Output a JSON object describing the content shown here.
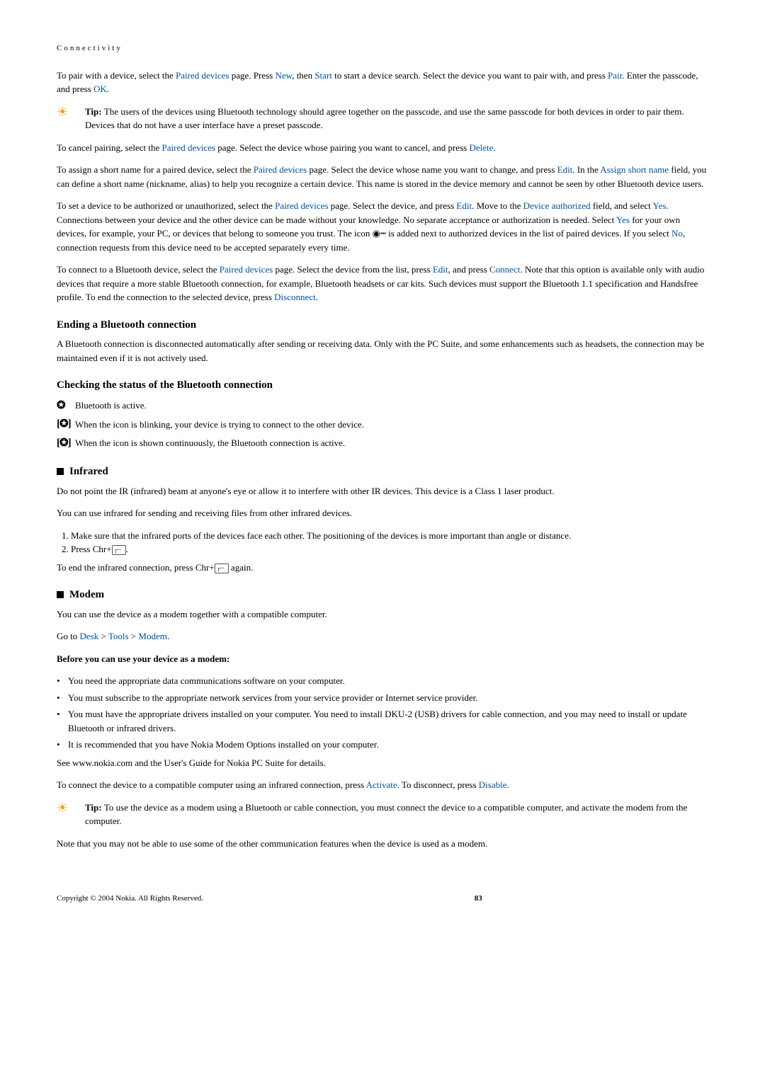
{
  "header": {
    "label": "Connectivity"
  },
  "p1": {
    "t1": "To pair with a device, select the ",
    "l1": "Paired devices",
    "t2": " page. Press ",
    "l2": "New",
    "t3": ", then ",
    "l3": "Start",
    "t4": " to start a device search. Select the device you want to pair with, and press ",
    "l4": "Pair",
    "t5": ". Enter the passcode, and press ",
    "l5": "OK",
    "t6": "."
  },
  "tip1": {
    "label": "Tip: ",
    "text": "The users of the devices using Bluetooth technology should agree together on the passcode, and use the same passcode for both devices in order to pair them. Devices that do not have a user interface have a preset passcode."
  },
  "p2": {
    "t1": "To cancel pairing, select the ",
    "l1": "Paired devices",
    "t2": " page. Select the device whose pairing you want to cancel, and press ",
    "l2": "Delete",
    "t3": "."
  },
  "p3": {
    "t1": "To assign a short name for a paired device, select the ",
    "l1": "Paired devices",
    "t2": " page. Select the device whose name you want to change, and press ",
    "l2": "Edit",
    "t3": ". In the ",
    "l3": "Assign short name",
    "t4": " field, you can define a short name (nickname, alias) to help you recognize a certain device. This name is stored in the device memory and cannot be seen by other Bluetooth device users."
  },
  "p4": {
    "t1": "To set a device to be authorized or unauthorized, select the ",
    "l1": "Paired devices",
    "t2": " page. Select the device, and press ",
    "l2": "Edit",
    "t3": ". Move to the ",
    "l3": "Device authorized",
    "t4": " field, and select ",
    "l4": "Yes",
    "t5": ". Connections between your device and the other device can be made without your knowledge. No separate acceptance or authorization is needed. Select ",
    "l5": "Yes",
    "t6": " for your own devices, for example, your PC, or devices that belong to someone you trust. The icon ",
    "t7": " is added next to authorized devices in the list of paired devices. If you select ",
    "l6": "No",
    "t8": ", connection requests from this device need to be accepted separately every time."
  },
  "p5": {
    "t1": "To connect to a Bluetooth device, select the ",
    "l1": "Paired devices",
    "t2": " page. Select the device from the list, press ",
    "l2": "Edit",
    "t3": ", and press ",
    "l3": "Connect",
    "t4": ". Note that this option is available only with audio devices that require a more stable Bluetooth connection, for example, Bluetooth headsets or car kits. Such devices must support the Bluetooth 1.1 specification and Handsfree profile. To end the connection to the selected device, press ",
    "l4": "Disconnect",
    "t5": "."
  },
  "h_ending": "Ending a Bluetooth connection",
  "p_ending": "A Bluetooth connection is disconnected automatically after sending or receiving data. Only with the PC Suite, and some enhancements such as headsets, the connection may be maintained even if it is not actively used.",
  "h_checking": "Checking the status of the Bluetooth connection",
  "status": {
    "s1": "Bluetooth is active.",
    "s2": "When the icon is blinking, your device is trying to connect to the other device.",
    "s3": "When the icon is shown continuously, the Bluetooth connection is active."
  },
  "h_infrared": "Infrared",
  "ir_p1": "Do not point the IR (infrared) beam at anyone's eye or allow it to interfere with other IR devices. This device is a Class 1 laser product.",
  "ir_p2": "You can use infrared for sending and receiving files from other infrared devices.",
  "ir_li1": "Make sure that the infrared ports of the devices face each other. The positioning of the devices is more important than angle or distance.",
  "ir_li2a": "Press Chr+",
  "ir_li2b": ".",
  "ir_p3a": "To end the infrared connection, press Chr+",
  "ir_p3b": " again.",
  "h_modem": "Modem",
  "md_p1": "You can use the device as a modem together with a compatible computer.",
  "md_goto": {
    "t1": "Go to ",
    "l1": "Desk",
    "t2": " > ",
    "l2": "Tools",
    "t3": " > ",
    "l3": "Modem",
    "t4": "."
  },
  "md_before": "Before you can use your device as a modem:",
  "md_b1": "You need the appropriate data communications software on your computer.",
  "md_b2": "You must subscribe to the appropriate network services from your service provider or Internet service provider.",
  "md_b3": "You must have the appropriate drivers installed on your computer. You need to install DKU-2 (USB) drivers for cable connection, and you may need to install or update Bluetooth or infrared drivers.",
  "md_b4": "It is recommended that you have Nokia Modem Options installed on your computer.",
  "md_p2": "See www.nokia.com and the User's Guide for Nokia PC Suite for details.",
  "md_p3": {
    "t1": "To connect the device to a compatible computer using an infrared connection, press ",
    "l1": "Activate",
    "t2": ". To disconnect, press ",
    "l2": "Disable",
    "t3": "."
  },
  "tip2": {
    "label": "Tip: ",
    "text": "To use the device as a modem using a Bluetooth or cable connection, you must connect the device to a compatible computer, and activate the modem from the computer."
  },
  "md_p4": "Note that you may not be able to use some of the other communication features when the device is used as a modem.",
  "footer": {
    "copyright": "Copyright © 2004 Nokia. All Rights Reserved.",
    "page": "83"
  }
}
